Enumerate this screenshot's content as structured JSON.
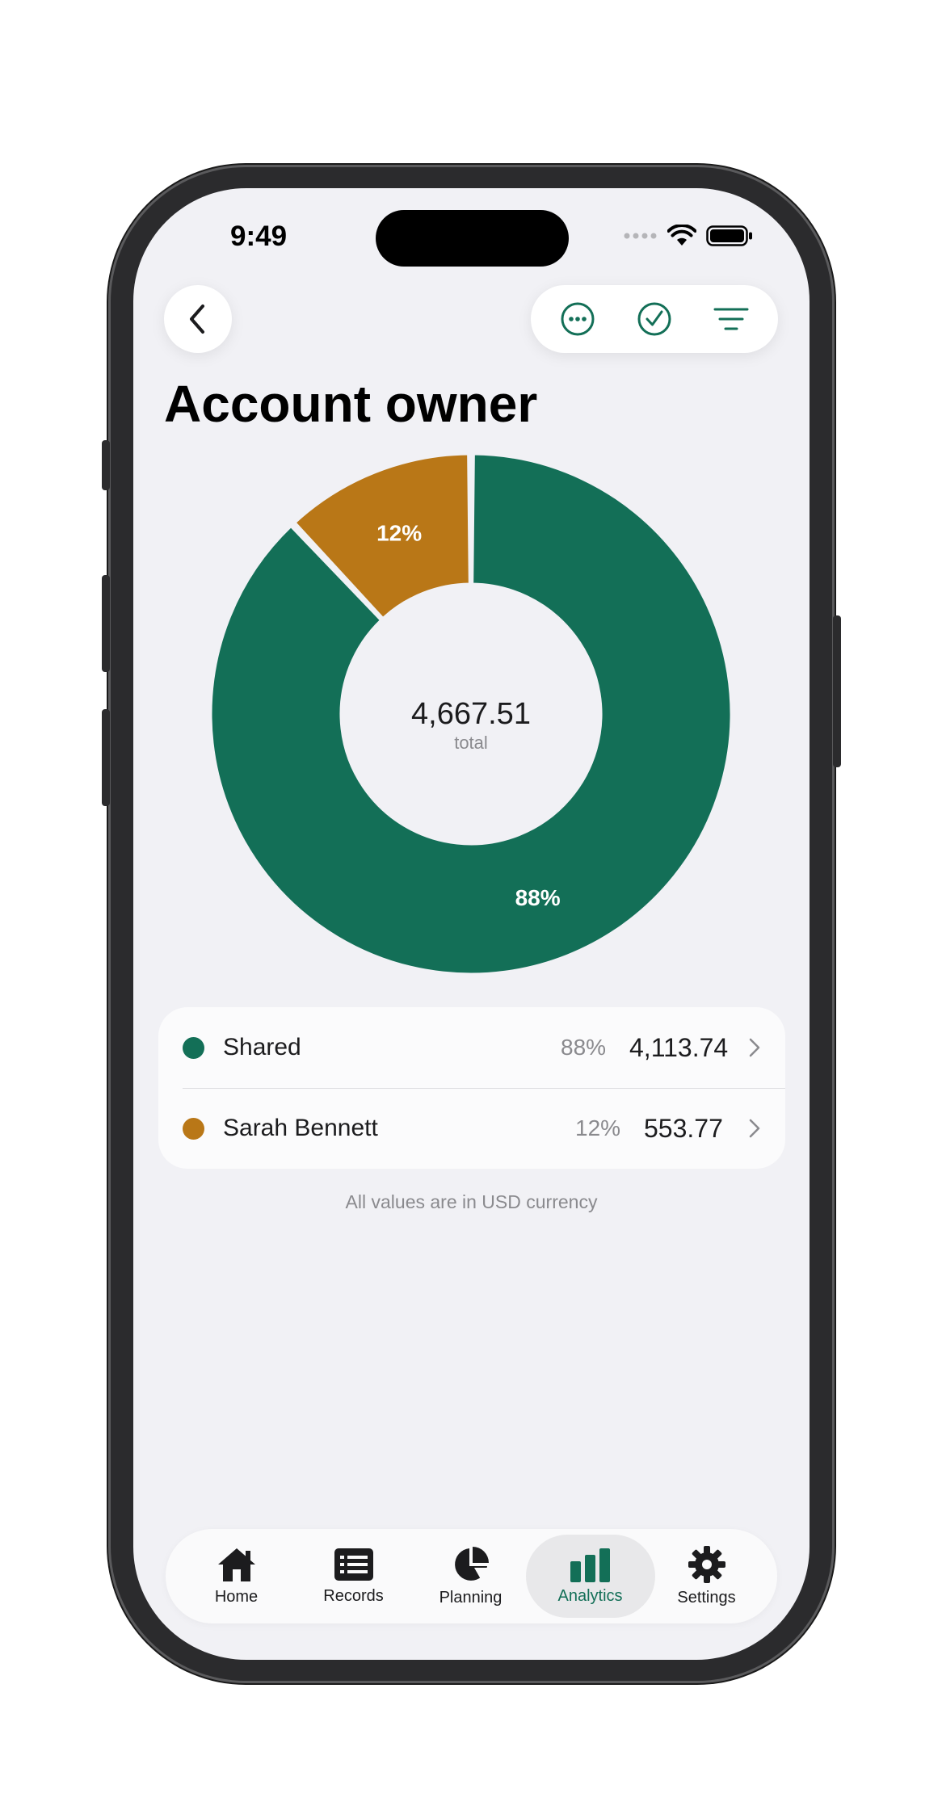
{
  "status_bar": {
    "time": "9:49"
  },
  "header": {
    "title": "Account owner"
  },
  "chart_data": {
    "type": "pie",
    "donut": true,
    "center_value": "4,667.51",
    "center_label": "total",
    "slices": [
      {
        "name": "Shared",
        "percent": 88,
        "value": 4113.74,
        "label": "88%",
        "color": "#136f57"
      },
      {
        "name": "Sarah Bennett",
        "percent": 12,
        "value": 553.77,
        "label": "12%",
        "color": "#b97717"
      }
    ]
  },
  "legend": [
    {
      "name": "Shared",
      "percent": "88%",
      "amount": "4,113.74",
      "color": "#136f57"
    },
    {
      "name": "Sarah Bennett",
      "percent": "12%",
      "amount": "553.77",
      "color": "#b97717"
    }
  ],
  "footnote": "All values are in USD currency",
  "tabs": [
    {
      "label": "Home",
      "icon": "home-icon"
    },
    {
      "label": "Records",
      "icon": "records-icon"
    },
    {
      "label": "Planning",
      "icon": "pie-chart-icon"
    },
    {
      "label": "Analytics",
      "icon": "bar-chart-icon",
      "active": true
    },
    {
      "label": "Settings",
      "icon": "gear-icon"
    }
  ],
  "colors": {
    "accent": "#136f57",
    "secondary": "#b97717",
    "background": "#f1f1f5"
  }
}
